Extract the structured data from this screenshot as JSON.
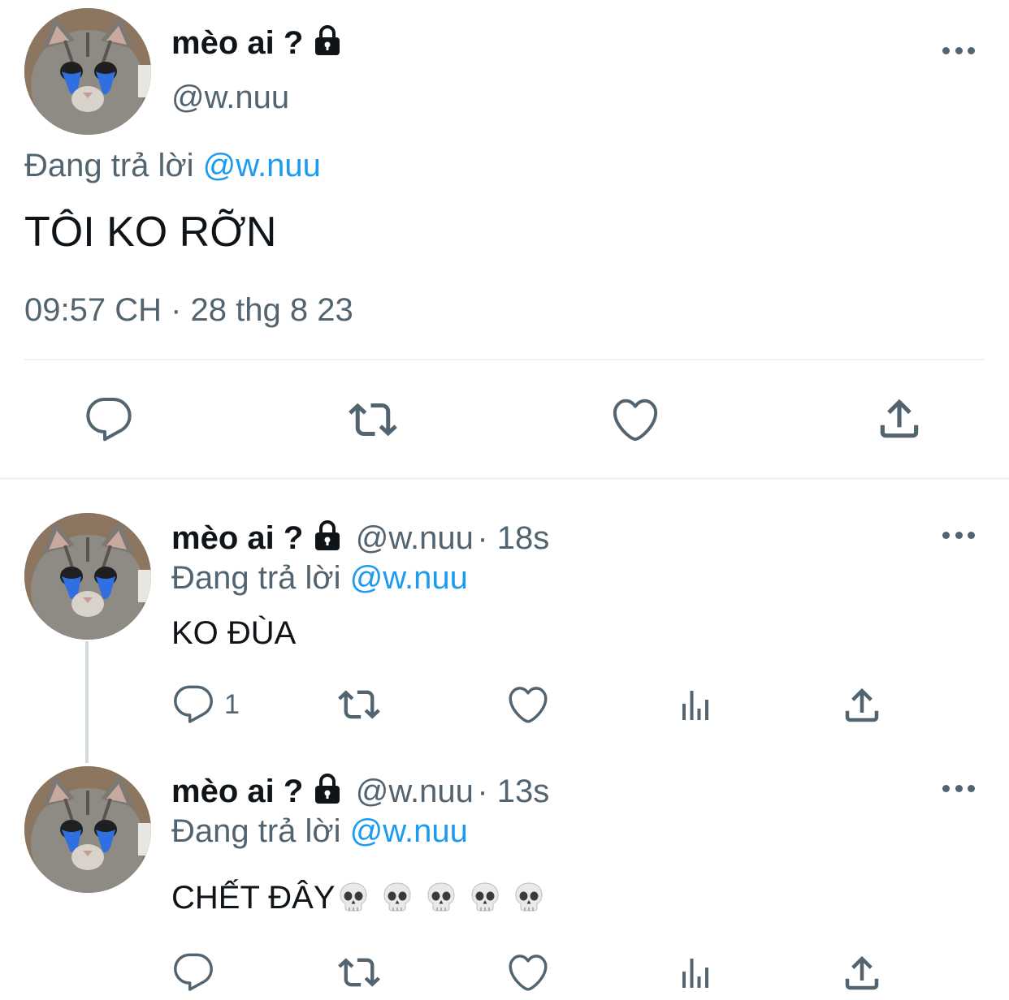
{
  "main_tweet": {
    "name": "mèo ai ?",
    "handle": "@w.nuu",
    "reply_prefix": "Đang trả lời",
    "reply_to": "@w.nuu",
    "text": "TÔI KO RỠN",
    "timestamp": "09:57 CH · 28 thg 8 23",
    "actions": [
      "reply-icon",
      "retweet-icon",
      "like-icon",
      "share-icon"
    ]
  },
  "replies": [
    {
      "name": "mèo ai ?",
      "handle": "@w.nuu",
      "time": "· 18s",
      "reply_prefix": "Đang trả lời",
      "reply_to": "@w.nuu",
      "text": "KO ĐÙA",
      "reply_count": "1"
    },
    {
      "name": "mèo ai ?",
      "handle": "@w.nuu",
      "time": "· 13s",
      "reply_prefix": "Đang trả lời",
      "reply_to": "@w.nuu",
      "text": "CHẾT ĐÂY",
      "emoji": [
        "skull",
        "skull",
        "skull",
        "skull",
        "skull"
      ],
      "reply_count": ""
    }
  ],
  "colors": {
    "text": "#0f1419",
    "muted": "#536471",
    "link": "#1d9bf0",
    "tear": "#2f6fe0"
  }
}
